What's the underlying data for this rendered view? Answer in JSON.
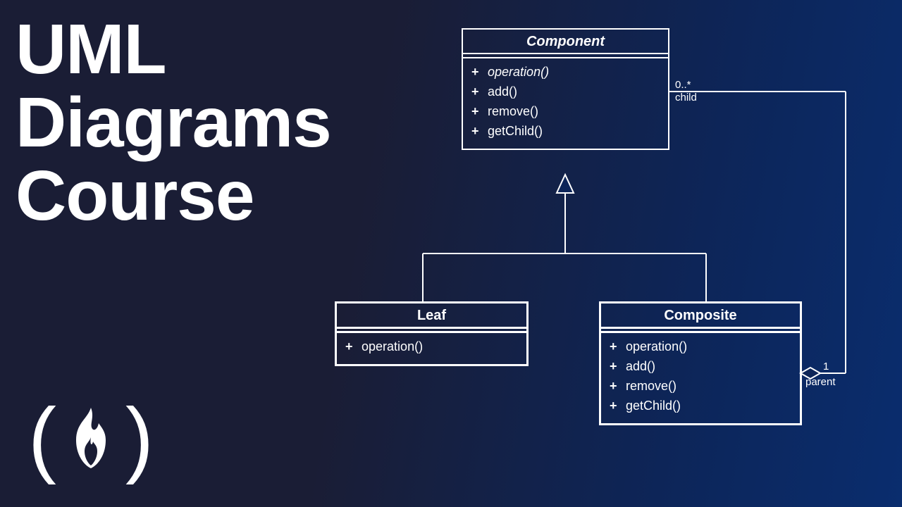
{
  "title_lines": [
    "UML",
    "Diagrams",
    "Course"
  ],
  "diagram": {
    "classes": {
      "component": {
        "name": "Component",
        "name_style": "italic",
        "operations": [
          {
            "vis": "+",
            "name": "operation()",
            "style": "italic"
          },
          {
            "vis": "+",
            "name": "add()"
          },
          {
            "vis": "+",
            "name": "remove()"
          },
          {
            "vis": "+",
            "name": "getChild()"
          }
        ]
      },
      "leaf": {
        "name": "Leaf",
        "operations": [
          {
            "vis": "+",
            "name": "operation()"
          }
        ]
      },
      "composite": {
        "name": "Composite",
        "operations": [
          {
            "vis": "+",
            "name": "operation()"
          },
          {
            "vis": "+",
            "name": "add()"
          },
          {
            "vis": "+",
            "name": "remove()"
          },
          {
            "vis": "+",
            "name": "getChild()"
          }
        ]
      }
    },
    "associations": {
      "child": {
        "multiplicity": "0..*",
        "role": "child"
      },
      "parent": {
        "multiplicity": "1",
        "role": "parent"
      }
    },
    "relationships": [
      {
        "type": "generalization",
        "from": "Leaf",
        "to": "Component"
      },
      {
        "type": "generalization",
        "from": "Composite",
        "to": "Component"
      },
      {
        "type": "aggregation",
        "whole": "Composite",
        "part": "Component",
        "whole_role": "parent",
        "whole_mult": "1",
        "part_role": "child",
        "part_mult": "0..*"
      }
    ]
  }
}
